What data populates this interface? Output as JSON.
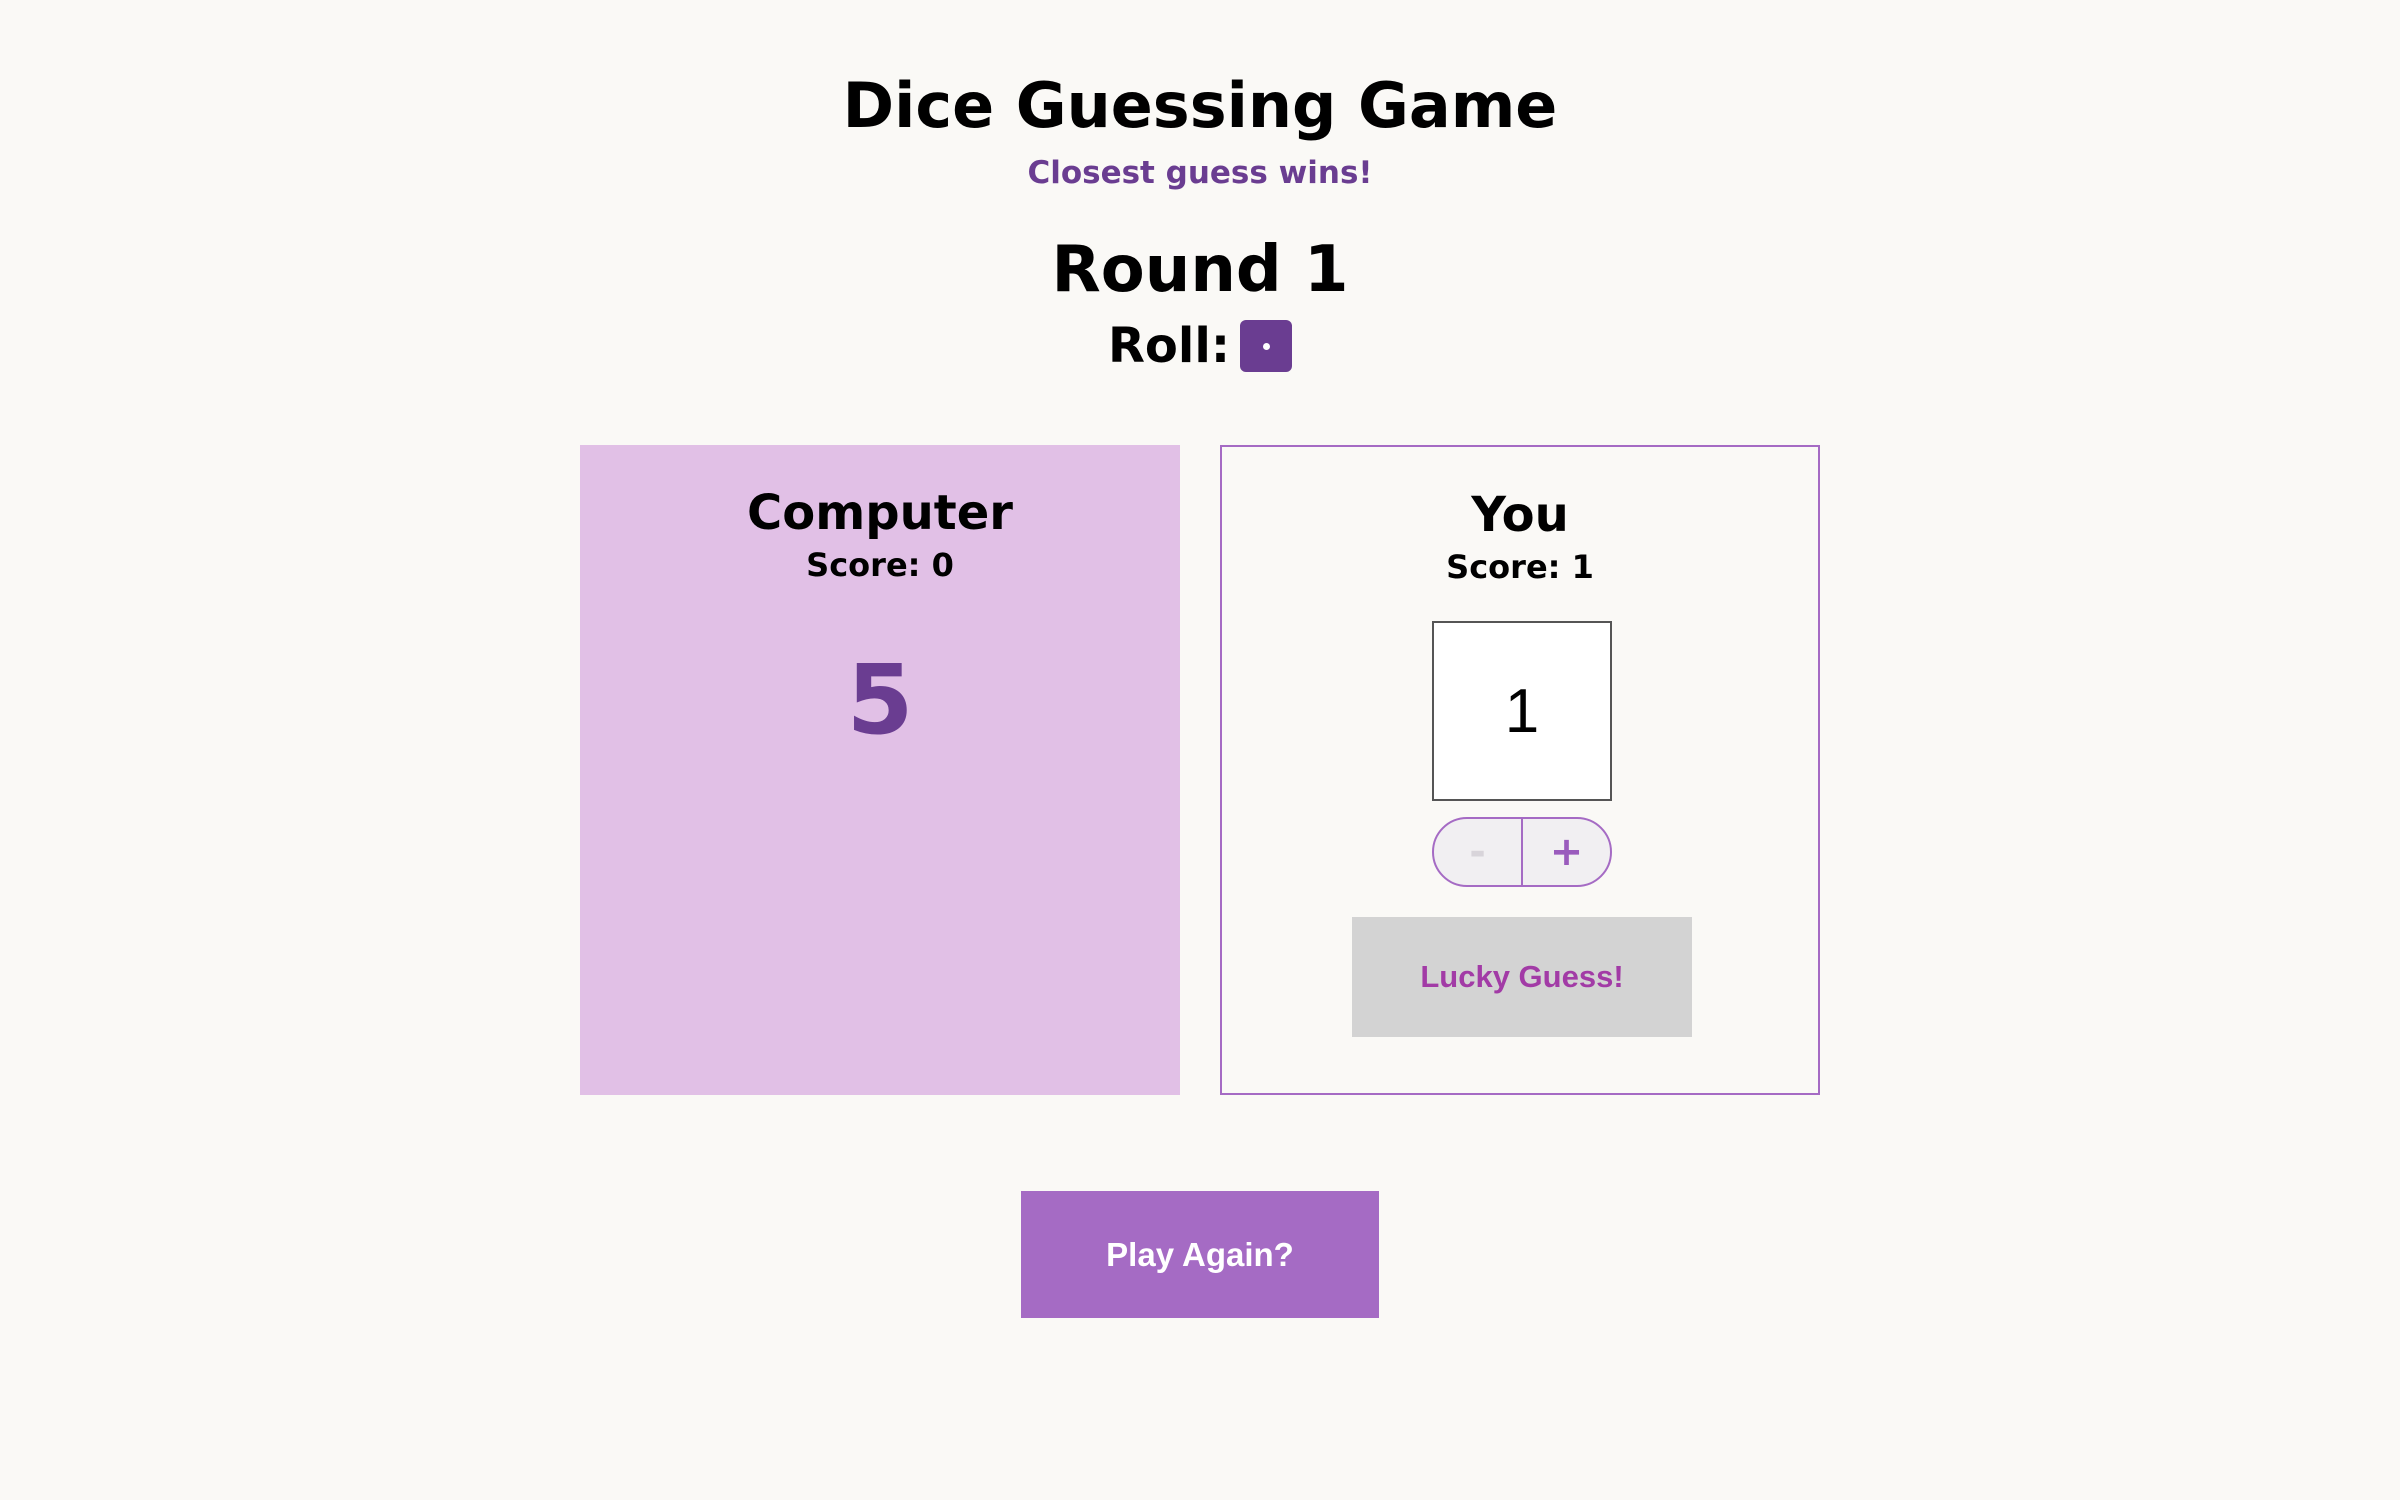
{
  "header": {
    "title": "Dice Guessing Game",
    "subtitle": "Closest guess wins!"
  },
  "round": {
    "label": "Round 1",
    "roll_label": "Roll:",
    "roll_value": 1,
    "die_icon": "dice-one-icon"
  },
  "computer": {
    "name": "Computer",
    "score": "Score: 0",
    "guess": "5"
  },
  "player": {
    "name": "You",
    "score": "Score: 1",
    "guess_value": "1",
    "minus_label": "-",
    "plus_label": "+",
    "submit_label": "Lucky Guess!"
  },
  "play_again_label": "Play Again?",
  "colors": {
    "background": "#faf9f6",
    "accent_dark": "#6a3d91",
    "accent": "#a56bc4",
    "computer_panel": "#e1c0e6",
    "lucky_button_bg": "#d3d3d3",
    "lucky_button_text": "#a23ba6"
  }
}
